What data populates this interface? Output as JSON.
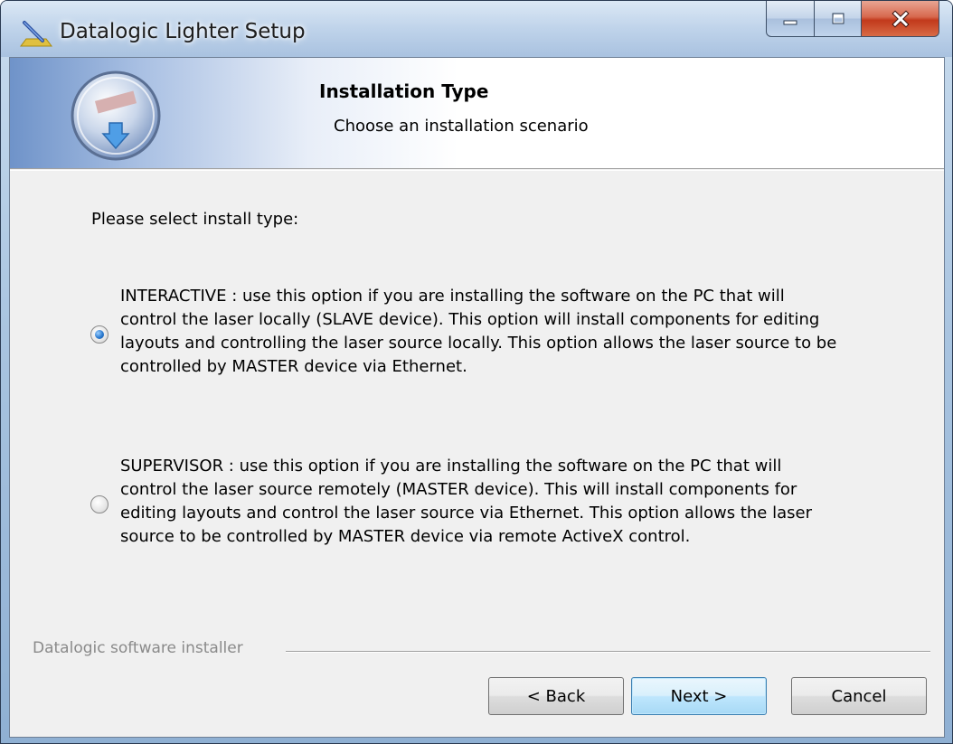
{
  "window": {
    "title": "Datalogic Lighter Setup",
    "caption_buttons": [
      "minimize",
      "maximize",
      "close"
    ]
  },
  "header": {
    "title": "Installation Type",
    "subtitle": "Choose an installation scenario"
  },
  "prompt": "Please select install type:",
  "options": [
    {
      "name": "interactive",
      "selected": true,
      "lines": [
        "INTERACTIVE : use this option if you are installing the software on the PC that will",
        "control the laser locally (SLAVE device). This option will install components for editing",
        "layouts and controlling the laser source locally. This option allows the laser source to be",
        "controlled by MASTER device via Ethernet."
      ]
    },
    {
      "name": "supervisor",
      "selected": false,
      "lines": [
        "SUPERVISOR : use this option if you are installing the software on the PC that will",
        "control the laser source remotely (MASTER device). This will install components for",
        "editing layouts and control the laser source via Ethernet. This option allows the laser",
        "source to be controlled by MASTER device via remote ActiveX control."
      ]
    }
  ],
  "footer": {
    "branding": "Datalogic software installer",
    "back_label": "< Back",
    "next_label": "Next >",
    "cancel_label": "Cancel"
  },
  "colors": {
    "title_bar": "#bfd3ea",
    "close_button": "#c2391b",
    "focused_button_border": "#3c7fb1",
    "dialog_background": "#f0f0f0"
  }
}
